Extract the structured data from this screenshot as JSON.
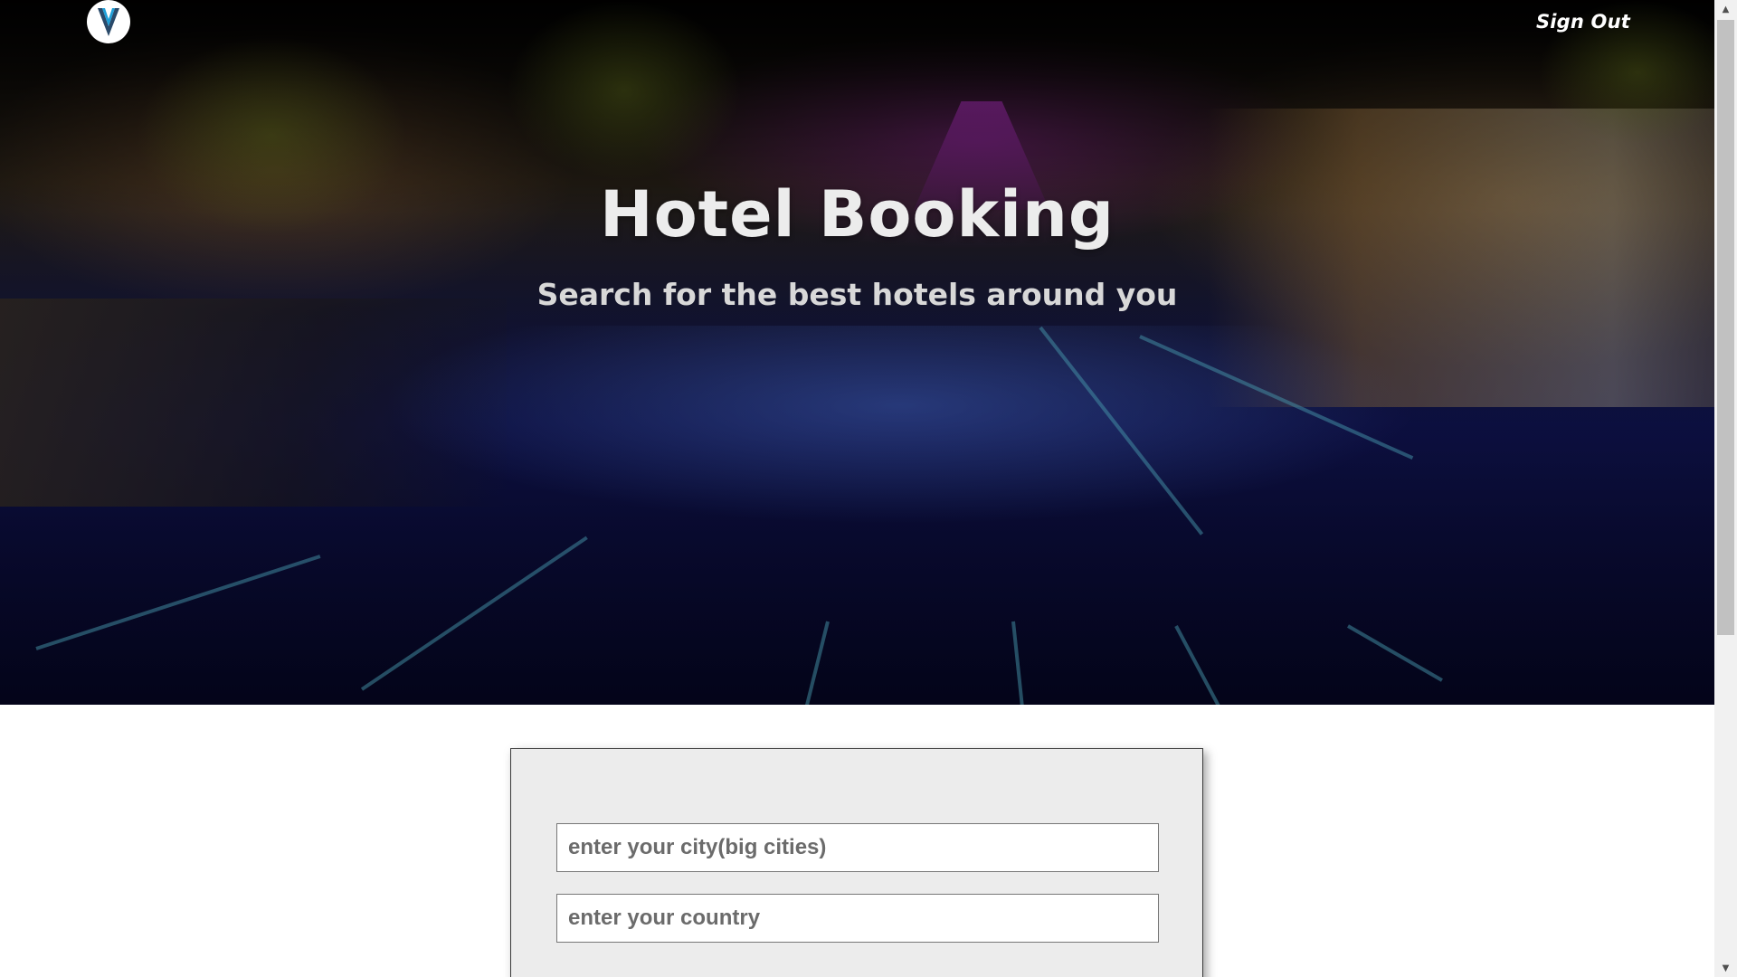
{
  "header": {
    "logo_letter": "V",
    "sign_out_label": "Sign Out"
  },
  "hero": {
    "title": "Hotel Booking",
    "subtitle": "Search for the best hotels around you"
  },
  "search": {
    "city_placeholder": "enter your city(big cities)",
    "country_placeholder": "enter your country"
  },
  "colors": {
    "logo_accent": "#1e9fd8",
    "card_background": "#ececec"
  },
  "icons": {
    "logo": "v-logo-icon",
    "scroll_up": "arrow-up-icon",
    "scroll_down": "arrow-down-icon"
  }
}
